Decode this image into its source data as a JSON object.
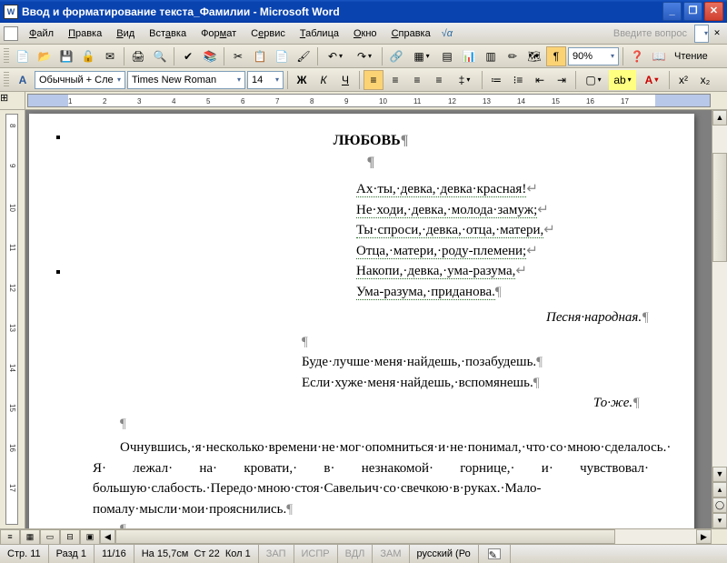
{
  "window": {
    "title": "Ввод и форматирование текста_Фамилии - Microsoft Word",
    "minimize": "_",
    "restore": "❐",
    "close": "✕"
  },
  "menu": {
    "file": "Файл",
    "edit": "Правка",
    "view": "Вид",
    "insert": "Вставка",
    "format": "Формат",
    "tools": "Сервис",
    "table": "Таблица",
    "window": "Окно",
    "help": "Справка",
    "math": "√α",
    "prompt": "Введите вопрос"
  },
  "toolbar": {
    "zoom": "90%",
    "read": "Чтение",
    "style": "Обычный + Сле",
    "font": "Times New Roman",
    "size": "14",
    "bold": "Ж",
    "italic": "К",
    "underline": "Ч"
  },
  "ruler": {
    "ticks": [
      "1",
      "2",
      "3",
      "4",
      "5",
      "6",
      "7",
      "8",
      "9",
      "10",
      "11",
      "12",
      "13",
      "14",
      "15",
      "16",
      "17"
    ],
    "vticks": [
      "8",
      "9",
      "10",
      "11",
      "12",
      "13",
      "14",
      "15",
      "16",
      "17"
    ]
  },
  "doc": {
    "title": "ЛЮБОВЬ",
    "poem": [
      "Ах·ты,·девка,·девка·красная!",
      "Не·ходи,·девка,·молода·замуж;",
      "Ты·спроси,·девка,·отца,·матери,",
      "Отца,·матери,·роду-племени;",
      "Накопи,·девка,·ума-разума,",
      "Ума-разума,·приданова."
    ],
    "attrib1": "Песня·народная.",
    "couplet": [
      "Буде·лучше·меня·найдешь,·позабудешь.",
      "Если·хуже·меня·найдешь,·вспомянешь."
    ],
    "attrib2": "То·же.",
    "paragraph": "Очнувшись,·я·несколько·времени·не·мог·опомниться·и·не·понимал,·что·со·мною·сделалось.· Я· лежал· на· кровати,· в· незнакомой· горнице,· и· чувствовал· большую·слабость.·Передо·мною·стоя·Савельич·со·свечкою·в·руках.·Мало-помалу·мысли·мои·прояснились."
  },
  "status": {
    "page": "Стр. 11",
    "section": "Разд 1",
    "pages": "11/16",
    "at": "На 15,7см",
    "line": "Ст 22",
    "col": "Кол 1",
    "rec": "ЗАП",
    "trk": "ИСПР",
    "ext": "ВДЛ",
    "ovr": "ЗАМ",
    "lang": "русский (Ро"
  }
}
